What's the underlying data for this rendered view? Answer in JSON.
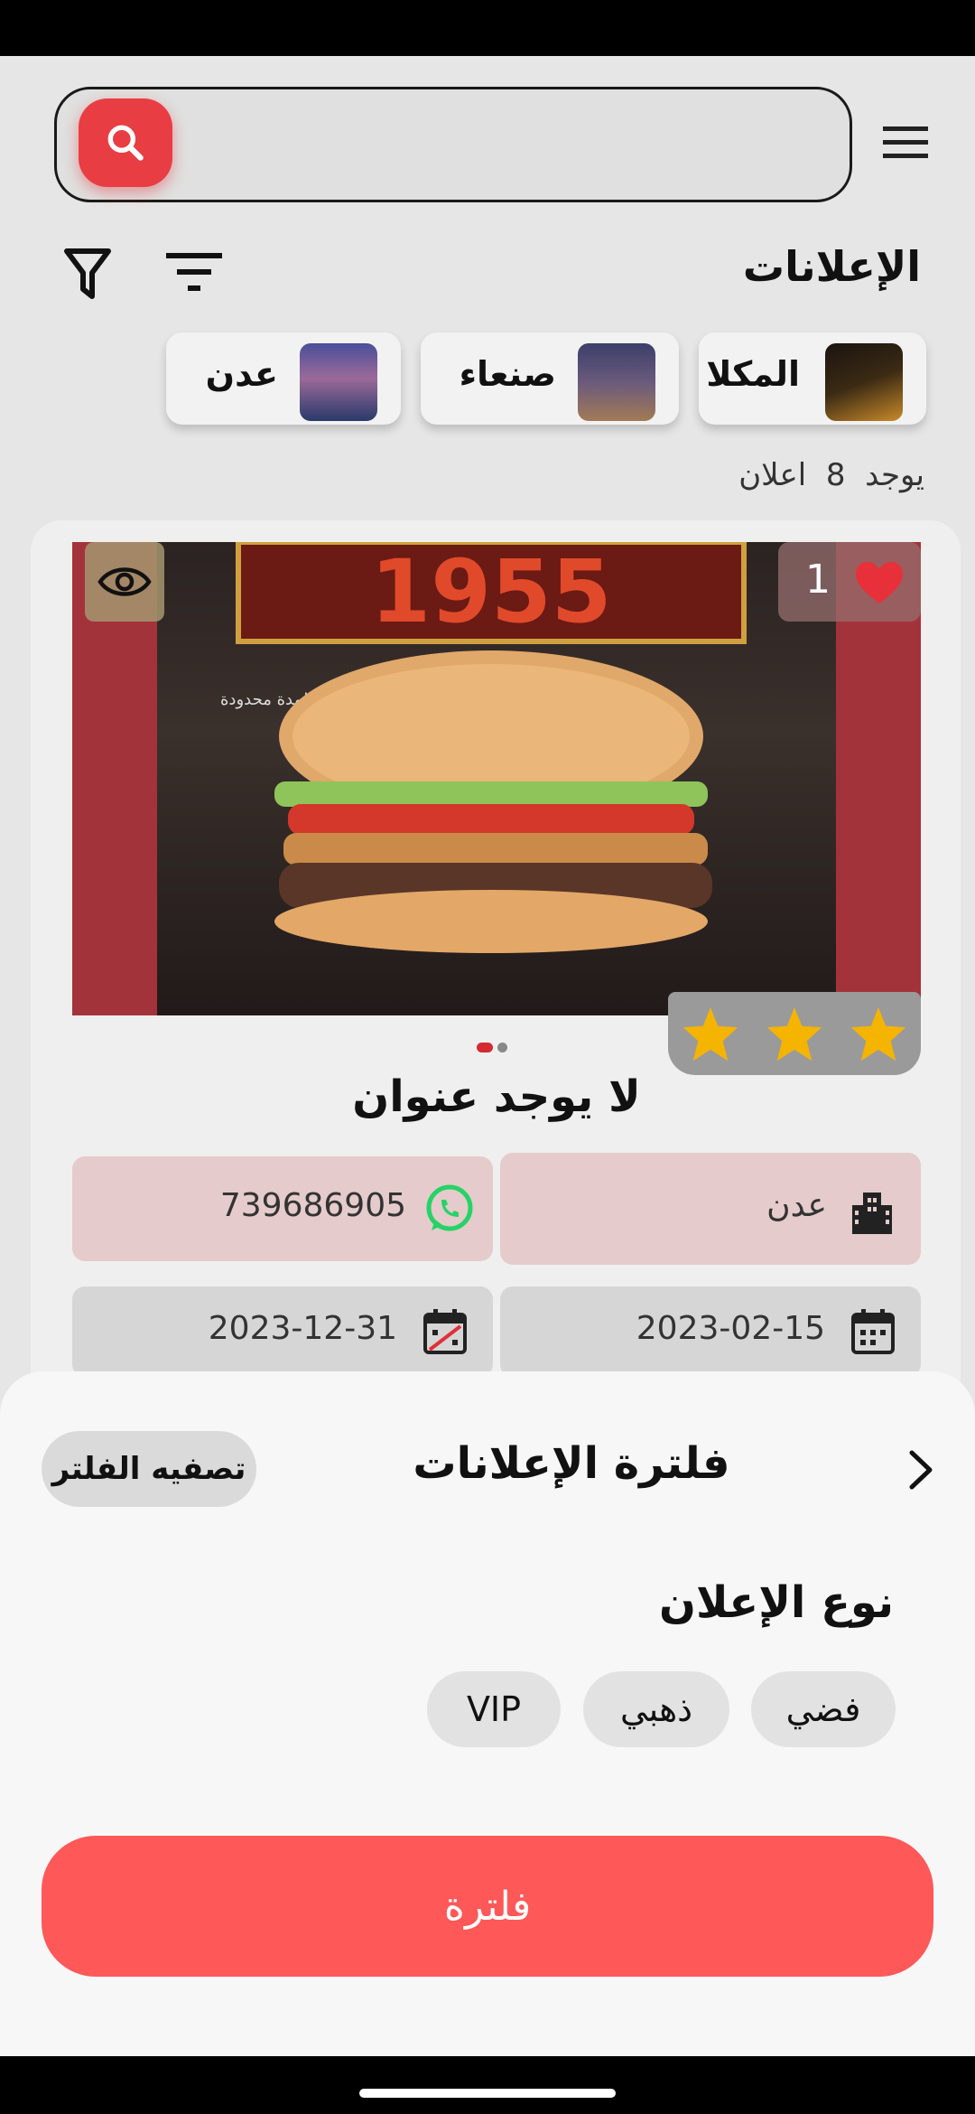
{
  "search": {
    "placeholder": ""
  },
  "header": {
    "title": "الإعلانات"
  },
  "cities": [
    {
      "name": "المكلا"
    },
    {
      "name": "صنعاء"
    },
    {
      "name": "عدن"
    }
  ],
  "results": {
    "prefix": "يوجد",
    "count": "8",
    "suffix": "اعلان"
  },
  "ad": {
    "banner_text": "1955",
    "caption_text": "لمدة محدودة",
    "likes": "1",
    "rating_stars": 3,
    "carousel": {
      "total": 2,
      "active": 1
    },
    "title": "لا يوجد عنوان",
    "city": "عدن",
    "phone": "739686905",
    "start_date": "2023-02-15",
    "end_date": "2023-12-31"
  },
  "filter_sheet": {
    "title": "فلترة الإعلانات",
    "clear_label": "تصفيه الفلتر",
    "section_title": "نوع الإعلان",
    "types": [
      "فضي",
      "ذهبي",
      "VIP"
    ],
    "apply_label": "فلترة"
  },
  "colors": {
    "accent": "#e83d43",
    "apply_button": "#fe5858",
    "whatsapp": "#25d366",
    "star": "#f5b400"
  }
}
